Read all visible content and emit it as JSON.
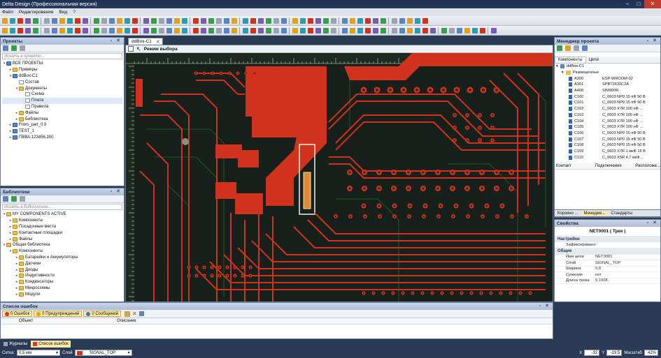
{
  "window": {
    "title": "Delta Design (Профессиональная версия)"
  },
  "menu": [
    "Файл",
    "Редактирование",
    "Вид",
    "?"
  ],
  "projects": {
    "title": "Проекты",
    "search_placeholder": "Искать в проекте...",
    "tree": [
      {
        "label": "ВСЕ ПРОЕКТЫ",
        "level": 0,
        "icon": "proj",
        "exp": "▾"
      },
      {
        "label": "Примеры",
        "level": 1,
        "icon": "fold",
        "exp": "▸"
      },
      {
        "label": "ddBox-C1",
        "level": 1,
        "icon": "proj",
        "exp": "▾"
      },
      {
        "label": "Состав",
        "level": 2,
        "icon": "doc",
        "exp": ""
      },
      {
        "label": "Документы",
        "level": 2,
        "icon": "fold",
        "exp": "▾"
      },
      {
        "label": "Схема",
        "level": 3,
        "icon": "doc",
        "exp": ""
      },
      {
        "label": "Плата",
        "level": 3,
        "icon": "doc",
        "exp": "",
        "sel": true
      },
      {
        "label": "Правила",
        "level": 3,
        "icon": "doc",
        "exp": ""
      },
      {
        "label": "Файлы",
        "level": 2,
        "icon": "fold",
        "exp": "▸"
      },
      {
        "label": "Библиотека",
        "level": 2,
        "icon": "fold",
        "exp": "▸"
      },
      {
        "label": "From_part_0.9",
        "level": 1,
        "icon": "proj",
        "exp": "▸"
      },
      {
        "label": "TEST_1",
        "level": 1,
        "icon": "proj",
        "exp": "▸"
      },
      {
        "label": "ПВВА.123456.200",
        "level": 1,
        "icon": "proj",
        "exp": "▸"
      }
    ]
  },
  "libraries": {
    "title": "Библиотеки",
    "search_placeholder": "Искать в библиотеке...",
    "tree": [
      {
        "label": "MY COMPONENTS ACTIVE",
        "level": 0,
        "icon": "fold",
        "exp": "▾"
      },
      {
        "label": "Компоненты",
        "level": 1,
        "icon": "fold",
        "exp": "▸"
      },
      {
        "label": "Посадочные места",
        "level": 1,
        "icon": "fold",
        "exp": "▸"
      },
      {
        "label": "Контактные площадки",
        "level": 1,
        "icon": "fold",
        "exp": "▸"
      },
      {
        "label": "Файлы",
        "level": 1,
        "icon": "fold",
        "exp": "▸"
      },
      {
        "label": "Общая библиотека",
        "level": 0,
        "icon": "fold",
        "exp": "▾"
      },
      {
        "label": "Компоненты",
        "level": 1,
        "icon": "fold",
        "exp": "▾"
      },
      {
        "label": "Батарейки и Аккумуляторы",
        "level": 2,
        "icon": "fold",
        "exp": "▸"
      },
      {
        "label": "Датчики",
        "level": 2,
        "icon": "fold",
        "exp": "▸"
      },
      {
        "label": "Диоды",
        "level": 2,
        "icon": "fold",
        "exp": "▸"
      },
      {
        "label": "Индуктивности",
        "level": 2,
        "icon": "fold",
        "exp": "▸"
      },
      {
        "label": "Конденсаторы",
        "level": 2,
        "icon": "fold",
        "exp": "▸"
      },
      {
        "label": "Микросхемы",
        "level": 2,
        "icon": "fold",
        "exp": "▸"
      },
      {
        "label": "Модули",
        "level": 2,
        "icon": "fold",
        "exp": "▸"
      }
    ]
  },
  "editor": {
    "tab": "ddBox-C1",
    "mode": "Режим выбора"
  },
  "errors": {
    "title": "Список ошибок",
    "errors_chip": "0 Ошибок",
    "warnings_chip": "0 Предупреждений",
    "messages_chip": "0 Сообщений",
    "col_object": "Объект",
    "col_description": "Описание"
  },
  "bottom_tabs": [
    "Журналы",
    "Список ошибок"
  ],
  "statusbar": {
    "grid_label": "Сетка:",
    "grid_value": "0,5 мм",
    "layer_label": "Слой",
    "layer_value": "SIGNAL_TOP",
    "x_label": "X",
    "x_value": "-32",
    "y_label": "Y",
    "y_value": "-19,5",
    "zoom_label": "Масштаб",
    "zoom_value": "42%"
  },
  "project_manager": {
    "title": "Менеджер проекта",
    "tabs": [
      "Компоненты",
      "Цепи"
    ],
    "root": "ddBox-C1",
    "placed": "Размещенные",
    "components": [
      [
        "A300",
        "ESP-WROOM-02"
      ],
      [
        "A301",
        "SPBT2632C2A"
      ],
      [
        "A400",
        "SIM900R"
      ],
      [
        "C100",
        "C_0603 NP0 15 пФ 50 В"
      ],
      [
        "C101",
        "C_0603 NP0 15 пФ 50 В"
      ],
      [
        "C102",
        "C_0603 X7R 100 нФ ..."
      ],
      [
        "C103",
        "C_0603 X7R 100 нФ ..."
      ],
      [
        "C104",
        "C_0603 X7R 100 нФ ..."
      ],
      [
        "C105",
        "C_0603 X7R 100 нФ ..."
      ],
      [
        "C106",
        "C_0603 NP0 15 пФ 50 В"
      ],
      [
        "C107",
        "C_0603 NP0 15 пФ 50 В"
      ],
      [
        "C108",
        "C_0603 NP0 15 пФ 50 В"
      ],
      [
        "C109",
        "C_0603 X7R 1 мкФ 16 В"
      ],
      [
        "C110",
        "C_0603 X5R 4,7 мкФ ..."
      ]
    ],
    "footer_cols": [
      "Контакт",
      "Подключение",
      "Расположе..."
    ],
    "bottom_tabs": [
      "Корзино ...",
      "Менедже...",
      "Стандарты"
    ]
  },
  "properties": {
    "title": "Свойства",
    "object": "NET0001 ( Трек )",
    "sections": [
      {
        "name": "Настройки",
        "rows": [
          [
            "Зафиксировано",
            ""
          ]
        ]
      },
      {
        "name": "Общие",
        "rows": [
          [
            "Имя цепи",
            "NET0001"
          ],
          [
            "Слой",
            "SIGNAL_TOP"
          ],
          [
            "Ширина",
            "0,8"
          ],
          [
            "Сужение",
            "нет"
          ],
          [
            "Длина трека",
            "5,1008"
          ]
        ]
      }
    ]
  },
  "colors": {
    "copper": "#d1321c",
    "board": "#1b2319",
    "accent": "#fbe9a8",
    "header": "#aebcd6"
  }
}
